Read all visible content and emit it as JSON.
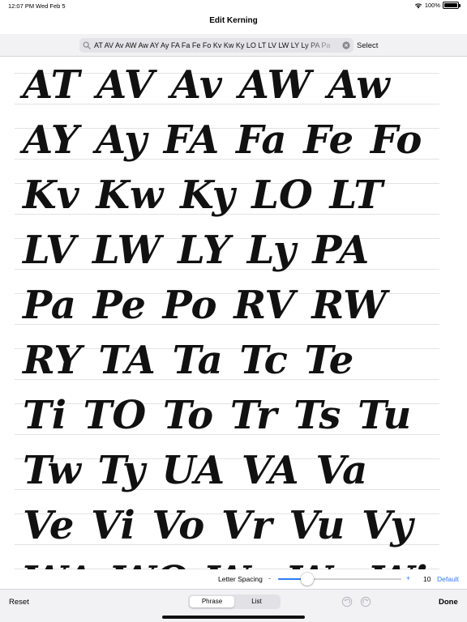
{
  "status_bar": {
    "time": "12:07 PM",
    "date": "Wed Feb 5",
    "battery": "100%"
  },
  "nav": {
    "title": "Edit Kerning"
  },
  "search": {
    "value": "AT AV Av AW Aw AY Ay  FA Fa Fe Fo  Kv Kw Ky LO LT LV LW LY Ly PA Pa",
    "select_label": "Select"
  },
  "preview": {
    "lines": [
      "AT AV Av AW Aw",
      "AY Ay  FA Fa Fe Fo",
      "Kv Kw Ky LO LT",
      "LV LW LY Ly PA",
      "Pa Pe Po RV RW",
      "RY TA Ta Tc Te",
      "Ti TO To Tr Ts Tu",
      "Tw Ty UA VA Va",
      "Ve Vi Vo Vr Vu Vy",
      "WA WO Wa We Wi"
    ]
  },
  "letter_spacing": {
    "label": "Letter Spacing",
    "minus": "-",
    "plus": "+",
    "value": "10",
    "slider_fraction": 0.24,
    "default_label": "Default"
  },
  "toolbar": {
    "reset_label": "Reset",
    "segments": [
      "Phrase",
      "List"
    ],
    "selected_segment": "Phrase",
    "done_label": "Done"
  },
  "colors": {
    "accent": "#2f7cf6",
    "text": "#111111",
    "bar_bg": "#f2f2f4"
  },
  "icons": [
    "wifi-icon",
    "battery-icon",
    "search-icon",
    "clear-icon",
    "undo-icon",
    "redo-icon"
  ]
}
